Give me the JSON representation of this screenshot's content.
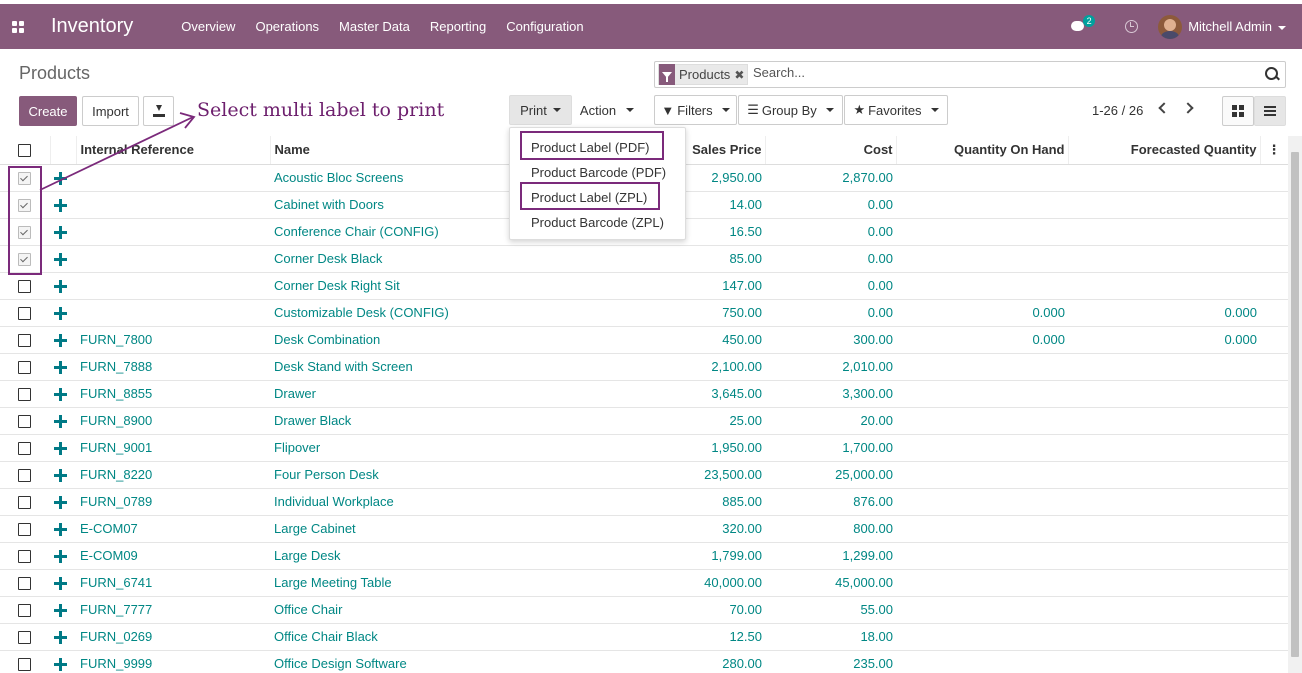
{
  "navbar": {
    "app_name": "Inventory",
    "menu": [
      "Overview",
      "Operations",
      "Master Data",
      "Reporting",
      "Configuration"
    ],
    "chat_badge": "2",
    "user": "Mitchell Admin",
    "color": "#875a7b"
  },
  "control_panel": {
    "breadcrumb": "Products",
    "search": {
      "facet": "Products",
      "placeholder": "Search..."
    },
    "buttons": {
      "create": "Create",
      "import": "Import",
      "print": "Print",
      "action": "Action",
      "filters": "Filters",
      "group_by": "Group By",
      "favorites": "Favorites"
    },
    "pager": "1-26 / 26"
  },
  "print_menu": [
    "Product Label (PDF)",
    "Product Barcode (PDF)",
    "Product Label (ZPL)",
    "Product Barcode (ZPL)"
  ],
  "annotation": "Select multi label to print",
  "table": {
    "columns": [
      "Internal Reference",
      "Name",
      "Sales Price",
      "Cost",
      "Quantity On Hand",
      "Forecasted Quantity"
    ],
    "rows": [
      {
        "checked": true,
        "ref": "",
        "name": "Acoustic Bloc Screens",
        "price": "2,950.00",
        "cost": "2,870.00",
        "qty": "",
        "forecast": ""
      },
      {
        "checked": true,
        "ref": "",
        "name": "Cabinet with Doors",
        "price": "14.00",
        "cost": "0.00",
        "qty": "",
        "forecast": ""
      },
      {
        "checked": true,
        "ref": "",
        "name": "Conference Chair (CONFIG)",
        "price": "16.50",
        "cost": "0.00",
        "qty": "",
        "forecast": ""
      },
      {
        "checked": true,
        "ref": "",
        "name": "Corner Desk Black",
        "price": "85.00",
        "cost": "0.00",
        "qty": "",
        "forecast": ""
      },
      {
        "checked": false,
        "ref": "",
        "name": "Corner Desk Right Sit",
        "price": "147.00",
        "cost": "0.00",
        "qty": "",
        "forecast": ""
      },
      {
        "checked": false,
        "ref": "",
        "name": "Customizable Desk (CONFIG)",
        "price": "750.00",
        "cost": "0.00",
        "qty": "0.000",
        "forecast": "0.000"
      },
      {
        "checked": false,
        "ref": "FURN_7800",
        "name": "Desk Combination",
        "price": "450.00",
        "cost": "300.00",
        "qty": "0.000",
        "forecast": "0.000"
      },
      {
        "checked": false,
        "ref": "FURN_7888",
        "name": "Desk Stand with Screen",
        "price": "2,100.00",
        "cost": "2,010.00",
        "qty": "",
        "forecast": ""
      },
      {
        "checked": false,
        "ref": "FURN_8855",
        "name": "Drawer",
        "price": "3,645.00",
        "cost": "3,300.00",
        "qty": "",
        "forecast": ""
      },
      {
        "checked": false,
        "ref": "FURN_8900",
        "name": "Drawer Black",
        "price": "25.00",
        "cost": "20.00",
        "qty": "",
        "forecast": ""
      },
      {
        "checked": false,
        "ref": "FURN_9001",
        "name": "Flipover",
        "price": "1,950.00",
        "cost": "1,700.00",
        "qty": "",
        "forecast": ""
      },
      {
        "checked": false,
        "ref": "FURN_8220",
        "name": "Four Person Desk",
        "price": "23,500.00",
        "cost": "25,000.00",
        "qty": "",
        "forecast": ""
      },
      {
        "checked": false,
        "ref": "FURN_0789",
        "name": "Individual Workplace",
        "price": "885.00",
        "cost": "876.00",
        "qty": "",
        "forecast": ""
      },
      {
        "checked": false,
        "ref": "E-COM07",
        "name": "Large Cabinet",
        "price": "320.00",
        "cost": "800.00",
        "qty": "",
        "forecast": ""
      },
      {
        "checked": false,
        "ref": "E-COM09",
        "name": "Large Desk",
        "price": "1,799.00",
        "cost": "1,299.00",
        "qty": "",
        "forecast": ""
      },
      {
        "checked": false,
        "ref": "FURN_6741",
        "name": "Large Meeting Table",
        "price": "40,000.00",
        "cost": "45,000.00",
        "qty": "",
        "forecast": ""
      },
      {
        "checked": false,
        "ref": "FURN_7777",
        "name": "Office Chair",
        "price": "70.00",
        "cost": "55.00",
        "qty": "",
        "forecast": ""
      },
      {
        "checked": false,
        "ref": "FURN_0269",
        "name": "Office Chair Black",
        "price": "12.50",
        "cost": "18.00",
        "qty": "",
        "forecast": ""
      },
      {
        "checked": false,
        "ref": "FURN_9999",
        "name": "Office Design Software",
        "price": "280.00",
        "cost": "235.00",
        "qty": "",
        "forecast": ""
      }
    ]
  }
}
